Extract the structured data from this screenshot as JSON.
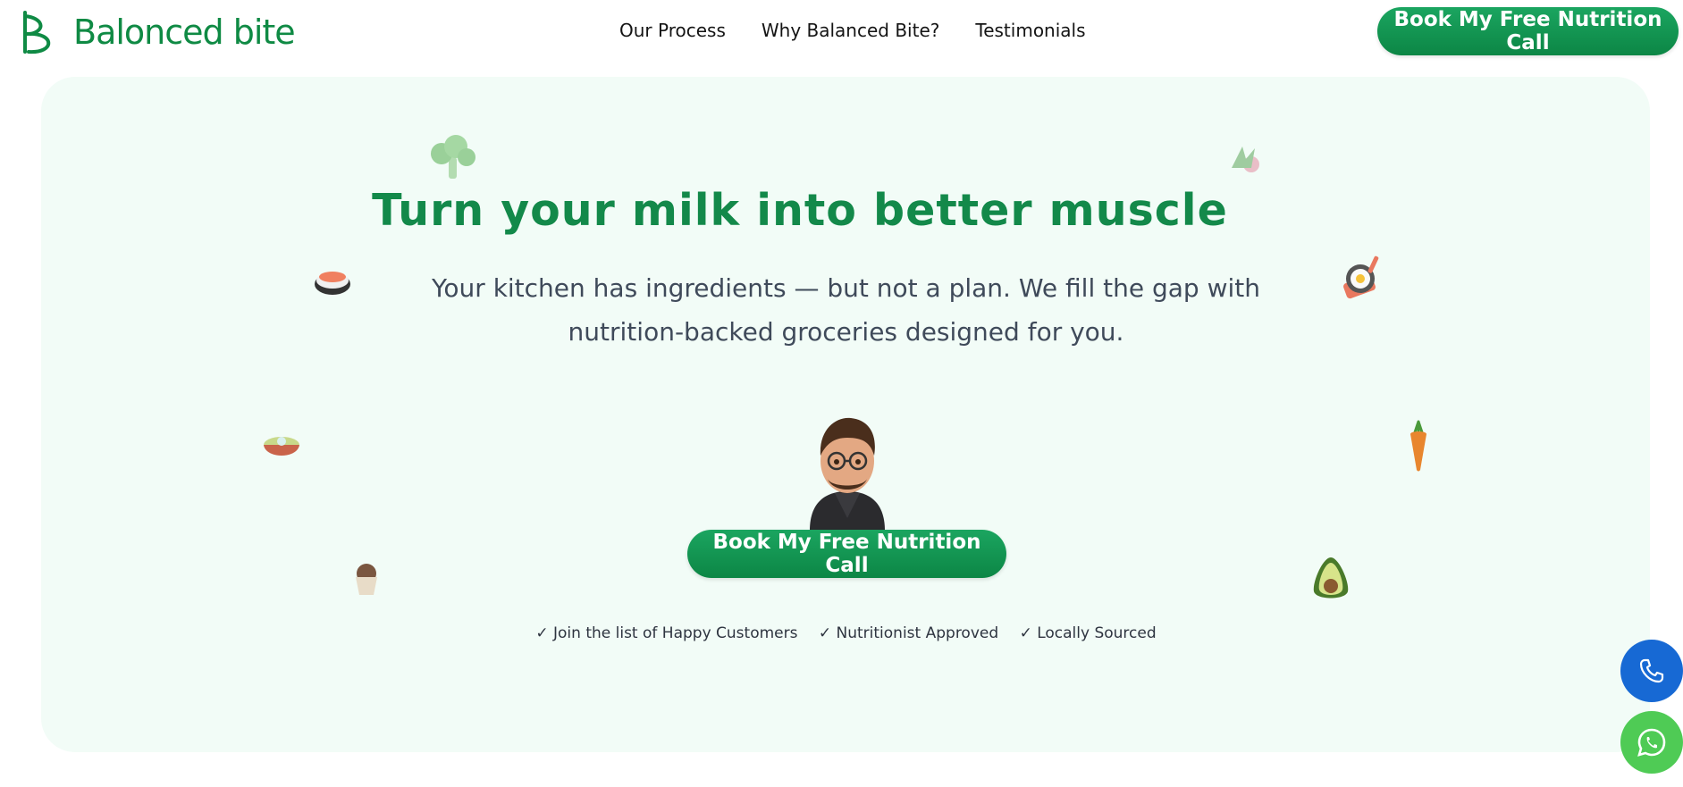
{
  "brand": {
    "name": "Balonced bite",
    "color": "#0f8a44"
  },
  "nav": {
    "items": [
      {
        "label": "Our Process"
      },
      {
        "label": "Why Balanced Bite?"
      },
      {
        "label": "Testimonials"
      }
    ]
  },
  "header": {
    "cta_label": "Book My Free Nutrition Call"
  },
  "hero": {
    "headline": "Turn your milk  into better muscle",
    "subtitle_line1": "Your kitchen has ingredients — but not a plan. We fill the gap with",
    "subtitle_line2": "nutrition-backed groceries designed for you.",
    "cta_label": "Book My Free Nutrition Call",
    "trust": [
      {
        "label": "✓ Join the list of Happy Customers"
      },
      {
        "label": "✓ Nutritionist Approved"
      },
      {
        "label": "✓ Locally Sourced"
      }
    ],
    "background": "#f2fcf7"
  },
  "icons": {
    "food": [
      "broccoli-icon",
      "herbs-icon",
      "sushi-icon",
      "frying-pan-egg-icon",
      "salad-bowl-icon",
      "carrot-icon",
      "muffin-icon",
      "avocado-icon"
    ],
    "floating": [
      "phone-icon",
      "whatsapp-icon"
    ]
  },
  "colors": {
    "accent": "#13894a",
    "button": "#129a52",
    "phone": "#1769d4",
    "whatsapp": "#4fcb55"
  }
}
